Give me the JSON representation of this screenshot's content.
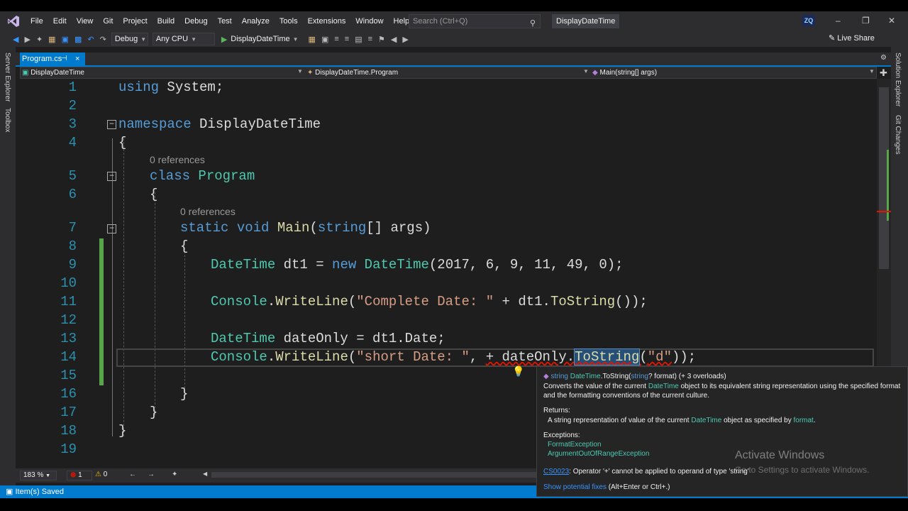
{
  "menu": {
    "items": [
      "File",
      "Edit",
      "View",
      "Git",
      "Project",
      "Build",
      "Debug",
      "Test",
      "Analyze",
      "Tools",
      "Extensions",
      "Window",
      "Help"
    ],
    "search_placeholder": "Search (Ctrl+Q)",
    "solution_title": "DisplayDateTime",
    "avatar_initials": "ZQ"
  },
  "toolbar": {
    "config": "Debug",
    "platform": "Any CPU",
    "run_target": "DisplayDateTime",
    "live_share": "Live Share"
  },
  "side_panels": {
    "left": [
      "Server Explorer",
      "Toolbox"
    ],
    "right": [
      "Solution Explorer",
      "Git Changes"
    ]
  },
  "tab": {
    "name": "Program.cs",
    "pin": "⊣",
    "close": "×"
  },
  "navbar": {
    "project": "DisplayDateTime",
    "class": "DisplayDateTime.Program",
    "member": "Main(string[] args)"
  },
  "editor": {
    "line_numbers": [
      "1",
      "2",
      "3",
      "4",
      "5",
      "6",
      "7",
      "8",
      "9",
      "10",
      "11",
      "12",
      "13",
      "14",
      "15",
      "16",
      "17",
      "18",
      "19"
    ],
    "references_label": "0 references"
  },
  "status": {
    "zoom": "183 %",
    "errors": "1",
    "warnings": "0",
    "message": "Item(s) Saved"
  },
  "tooltip": {
    "signature_return": "string",
    "signature_type": "DateTime",
    "signature_method": ".ToString(",
    "signature_param_type": "string",
    "signature_param": "? format)",
    "signature_overloads": "(+ 3 overloads)",
    "desc_1a": "Converts the value of the current ",
    "desc_1b": "DateTime",
    "desc_1c": " object to its equivalent string representation using the specified format",
    "desc_2": "and the formatting conventions of the current culture.",
    "returns_label": "Returns:",
    "returns_a": "A string representation of value of the current ",
    "returns_b": "DateTime",
    "returns_c": " object as specified by ",
    "returns_d": "format",
    "returns_e": ".",
    "exceptions_label": "Exceptions:",
    "exceptions": [
      "FormatException",
      "ArgumentOutOfRangeException"
    ],
    "error_code": "CS0023",
    "error_text": ": Operator '+' cannot be applied to operand of type 'string'",
    "fix_link": "Show potential fixes",
    "fix_shortcut": " (Alt+Enter or Ctrl+.)"
  },
  "watermark": {
    "title": "Activate Windows",
    "subtitle": "Go to Settings to activate Windows."
  },
  "colors": {
    "accent": "#007acc",
    "keyword": "#569cd6",
    "type": "#4ec9b0",
    "method": "#dcdcaa",
    "string": "#d69d85",
    "line_number": "#2b91af",
    "changed": "#57a64a",
    "error": "#e51400"
  }
}
